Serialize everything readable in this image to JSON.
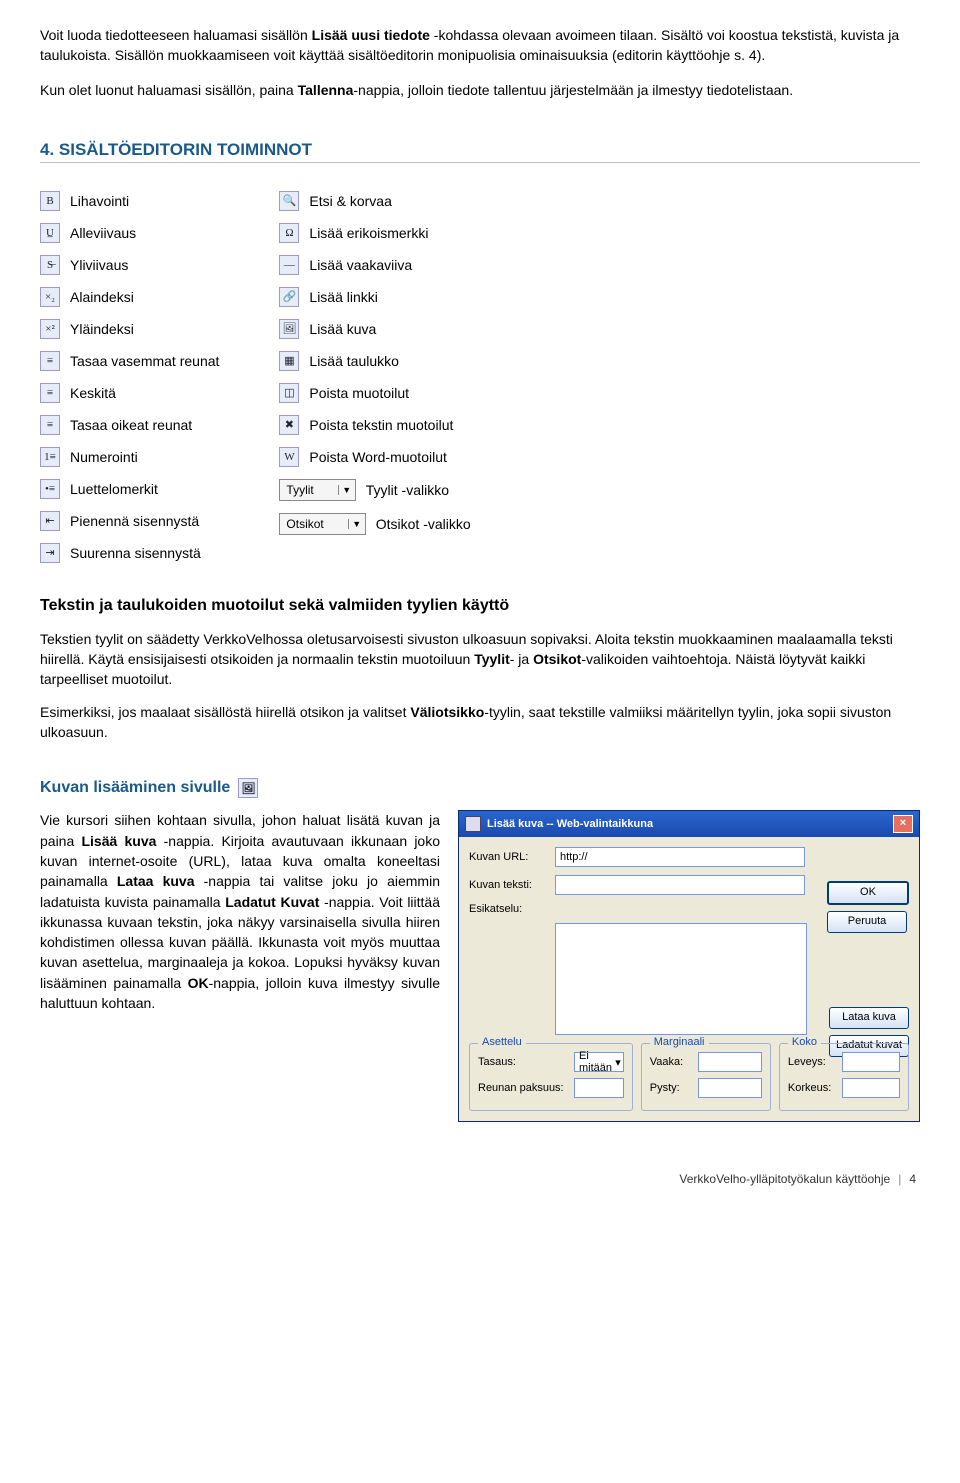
{
  "intro": {
    "p1a": "Voit luoda tiedotteeseen haluamasi sisällön ",
    "p1b": "Lisää uusi tiedote",
    "p1c": " -kohdassa olevaan avoimeen tilaan. Sisältö voi koostua tekstistä, kuvista ja taulukoista. Sisällön muokkaamiseen voit käyttää sisältöeditorin monipuolisia ominaisuuksia (editorin käyttöohje s. 4).",
    "p2a": "Kun olet luonut haluamasi sisällön, paina ",
    "p2b": "Tallenna",
    "p2c": "-nappia, jolloin tiedote tallentuu järjestelmään ja ilmestyy tiedotelistaan."
  },
  "section4": {
    "title": "4. SISÄLTÖEDITORIN TOIMINNOT",
    "left": [
      {
        "icon": "B",
        "label": "Lihavointi",
        "name": "bold-icon"
      },
      {
        "icon": "U̲",
        "label": "Alleviivaus",
        "name": "underline-icon"
      },
      {
        "icon": "S̶",
        "label": "Yliviivaus",
        "name": "strikethrough-icon"
      },
      {
        "icon": "×₂",
        "label": "Alaindeksi",
        "name": "subscript-icon"
      },
      {
        "icon": "×²",
        "label": "Yläindeksi",
        "name": "superscript-icon"
      },
      {
        "icon": "≡",
        "label": "Tasaa vasemmat reunat",
        "name": "align-left-icon"
      },
      {
        "icon": "≡",
        "label": "Keskitä",
        "name": "align-center-icon"
      },
      {
        "icon": "≡",
        "label": "Tasaa oikeat reunat",
        "name": "align-right-icon"
      },
      {
        "icon": "1≡",
        "label": "Numerointi",
        "name": "numbered-list-icon"
      },
      {
        "icon": "•≡",
        "label": "Luettelomerkit",
        "name": "bullet-list-icon"
      },
      {
        "icon": "⇤",
        "label": "Pienennä sisennystä",
        "name": "decrease-indent-icon"
      },
      {
        "icon": "⇥",
        "label": "Suurenna sisennystä",
        "name": "increase-indent-icon"
      }
    ],
    "right": [
      {
        "icon": "🔍",
        "label": "Etsi & korvaa",
        "name": "find-replace-icon"
      },
      {
        "icon": "Ω",
        "label": "Lisää erikoismerkki",
        "name": "special-char-icon"
      },
      {
        "icon": "—",
        "label": "Lisää vaakaviiva",
        "name": "horizontal-rule-icon"
      },
      {
        "icon": "🔗",
        "label": "Lisää linkki",
        "name": "link-icon"
      },
      {
        "icon": "🖼",
        "label": "Lisää kuva",
        "name": "image-icon"
      },
      {
        "icon": "▦",
        "label": "Lisää taulukko",
        "name": "table-icon"
      },
      {
        "icon": "◫",
        "label": "Poista muotoilut",
        "name": "clear-format-icon"
      },
      {
        "icon": "✖",
        "label": "Poista tekstin muotoilut",
        "name": "clear-text-format-icon"
      },
      {
        "icon": "W",
        "label": "Poista Word-muotoilut",
        "name": "clear-word-format-icon"
      }
    ],
    "dropdowns": [
      {
        "display": "Tyylit",
        "label": "Tyylit -valikko",
        "name": "styles-select"
      },
      {
        "display": "Otsikot",
        "label": "Otsikot -valikko",
        "name": "headings-select"
      }
    ]
  },
  "styling": {
    "title": "Tekstin ja taulukoiden muotoilut sekä valmiiden tyylien käyttö",
    "p1a": "Tekstien tyylit on säädetty VerkkoVelhossa oletusarvoisesti sivuston ulkoasuun sopivaksi. Aloita tekstin muokkaaminen maalaamalla teksti hiirellä. Käytä ensisijaisesti otsikoiden ja normaalin tekstin muotoiluun ",
    "p1b": "Tyylit",
    "p1c": "- ja ",
    "p1d": "Otsikot",
    "p1e": "-valikoiden vaihtoehtoja. Näistä löytyvät kaikki tarpeelliset muotoilut.",
    "p2a": "Esimerkiksi, jos maalaat sisällöstä hiirellä otsikon ja valitset ",
    "p2b": "Väliotsikko",
    "p2c": "-tyylin, saat tekstille valmiiksi määritellyn tyylin, joka sopii sivuston ulkoasuun."
  },
  "imgsection": {
    "title": "Kuvan lisääminen sivulle",
    "pa": "Vie kursori siihen kohtaan sivulla, johon haluat lisätä kuvan ja paina ",
    "pb": "Lisää kuva",
    "pc": " -nappia. Kirjoita avautuvaan ikkunaan joko kuvan internet-osoite (URL), lataa kuva omalta koneeltasi painamalla ",
    "pd": "Lataa kuva",
    "pe": " -nappia tai valitse joku jo aiemmin ladatuista kuvista painamalla ",
    "pf": "Ladatut Kuvat",
    "pg": " -nappia. Voit liittää ikkunassa kuvaan tekstin, joka näkyy varsinaisella sivulla hiiren kohdistimen ollessa kuvan päällä. Ikkunasta voit myös muuttaa kuvan asettelua, marginaaleja ja kokoa. Lopuksi hyväksy kuvan lisääminen painamalla ",
    "ph": "OK",
    "pi": "-nappia, jolloin kuva ilmestyy sivulle haluttuun kohtaan."
  },
  "dialog": {
    "title": "Lisää kuva -- Web-valintaikkuna",
    "url_label": "Kuvan URL:",
    "url_value": "http://",
    "text_label": "Kuvan teksti:",
    "preview_label": "Esikatselu:",
    "ok": "OK",
    "cancel": "Peruuta",
    "load": "Lataa kuva",
    "loaded": "Ladatut kuvat",
    "fs_layout": "Asettelu",
    "fs_margin": "Marginaali",
    "fs_size": "Koko",
    "align_label": "Tasaus:",
    "align_value": "Ei mitään",
    "border_label": "Reunan paksuus:",
    "h_label": "Vaaka:",
    "v_label": "Pysty:",
    "w_label": "Leveys:",
    "ht_label": "Korkeus:"
  },
  "footer": {
    "doc": "VerkkoVelho-ylläpitotyökalun käyttöohje",
    "page": "4"
  }
}
